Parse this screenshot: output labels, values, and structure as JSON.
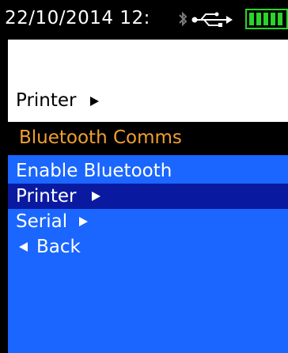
{
  "statusbar": {
    "datetime": "22/10/2014  12:",
    "icons": [
      "bluetooth-icon",
      "usb-icon",
      "battery-icon"
    ],
    "battery_color": "#2bd42b"
  },
  "breadcrumb": {
    "parent_label": "Printer"
  },
  "menu": {
    "title": "Bluetooth Comms",
    "title_color": "#f0a030",
    "panel_color": "#1a66ff",
    "selected_color": "#0a1aa0",
    "items": [
      {
        "label": "Enable Bluetooth",
        "icon": "",
        "selected": false
      },
      {
        "label": "Printer",
        "icon": "arrow-right-icon",
        "selected": true
      },
      {
        "label": "Serial",
        "icon": "arrow-right-icon",
        "selected": false
      },
      {
        "label": "Back",
        "icon": "arrow-left-icon",
        "selected": false
      }
    ]
  }
}
